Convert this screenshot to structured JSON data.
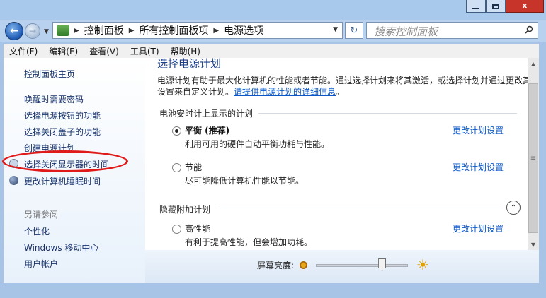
{
  "window": {
    "minimize_icon": "minimize-icon",
    "maximize_icon": "maximize-icon",
    "close_label": "x"
  },
  "nav": {
    "back_glyph": "←",
    "forward_glyph": "→",
    "breadcrumbs": [
      "控制面板",
      "所有控制面板项",
      "电源选项"
    ],
    "refresh_glyph": "↻",
    "search_placeholder": "搜索控制面板"
  },
  "menu": [
    "文件(F)",
    "编辑(E)",
    "查看(V)",
    "工具(T)",
    "帮助(H)"
  ],
  "sidebar": {
    "home": "控制面板主页",
    "links": [
      "唤醒时需要密码",
      "选择电源按钮的功能",
      "选择关闭盖子的功能",
      "创建电源计划",
      "选择关闭显示器的时间",
      "更改计算机睡眠时间"
    ],
    "see_also_heading": "另请参阅",
    "see_also": [
      "个性化",
      "Windows 移动中心",
      "用户帐户"
    ]
  },
  "main": {
    "title": "选择电源计划",
    "description": "电源计划有助于最大化计算机的性能或者节能。通过选择计划来将其激活，或选择计划并通过更改其电源设置来自定义计划。",
    "learn_more": "请提供电源计划的详细信息",
    "battery_group": "电池安时计上显示的计划",
    "hidden_group": "隐藏附加计划",
    "change_plan_label": "更改计划设置",
    "plans": [
      {
        "name": "平衡 (推荐)",
        "desc": "利用可用的硬件自动平衡功耗与性能。",
        "selected": true
      },
      {
        "name": "节能",
        "desc": "尽可能降低计算机性能以节能。",
        "selected": false
      },
      {
        "name": "高性能",
        "desc": "有利于提高性能，但会增加功耗。",
        "selected": false
      }
    ],
    "collapse_glyph": "⌃"
  },
  "brightness": {
    "label": "屏幕亮度:",
    "level_percent": 72
  },
  "colors": {
    "link": "#0b57c7",
    "title": "#1c3f8a",
    "highlight_ellipse": "#e01919"
  }
}
